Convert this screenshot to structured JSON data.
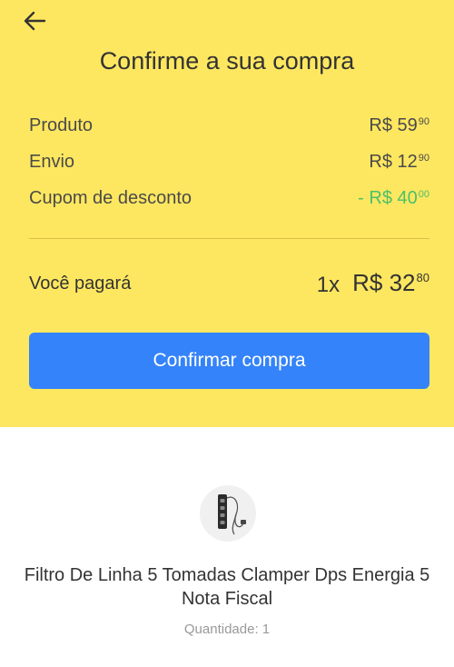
{
  "header": {
    "back_icon": "arrow-left-icon",
    "title": "Confirme a sua compra"
  },
  "summary": {
    "produto": {
      "label": "Produto",
      "main": "R$ 59",
      "cents": "90"
    },
    "envio": {
      "label": "Envio",
      "main": "R$ 12",
      "cents": "90"
    },
    "cupom": {
      "label": "Cupom de desconto",
      "main": "- R$ 40",
      "cents": "00",
      "color": "#4cc06a"
    }
  },
  "total": {
    "label": "Você pagará",
    "quantity": "1x",
    "main": "R$ 32",
    "cents": "80"
  },
  "confirm_button": {
    "label": "Confirmar compra",
    "color": "#3483fa"
  },
  "product": {
    "image_icon": "power-strip-icon",
    "name": "Filtro De Linha 5 Tomadas Clamper Dps Energia 5 Nota Fiscal",
    "quantity": "Quantidade: 1"
  },
  "colors": {
    "header_background": "#fee760",
    "page_background": "#ffffff"
  }
}
